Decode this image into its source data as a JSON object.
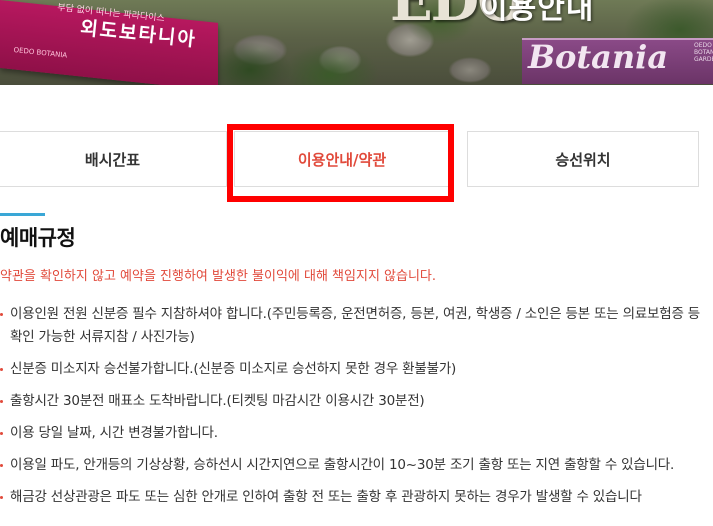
{
  "hero": {
    "sign_subtitle": "부담 없이 떠나는 파라다이스",
    "sign_title": "외도보타니아",
    "sign_small": "OEDO BOTANIA",
    "stone_letters": "EDO",
    "page_title": "이용안내",
    "purple_sign": "Botania",
    "purple_small": "OEDO BOTANIA GARDEN"
  },
  "tabs": [
    {
      "label": "배시간표"
    },
    {
      "label": "이용안내/약관"
    },
    {
      "label": "승선위치"
    }
  ],
  "active_tab_index": 1,
  "section": {
    "title": "예매규정",
    "warning": "약관을 확인하지 않고 예약을 진행하여 발생한 불이익에 대해 책임지지 않습니다.",
    "rules": [
      "이용인원 전원 신분증 필수 지참하셔야 합니다.(주민등록증, 운전면허증, 등본, 여권, 학생증 / 소인은 등본 또는 의료보험증 등 확인 가능한 서류지참 / 사진가능)",
      "신분증 미소지자 승선불가합니다.(신분증 미소지로 승선하지 못한 경우 환불불가)",
      "출항시간 30분전 매표소 도착바랍니다.(티켓팅 마감시간 이용시간 30분전)",
      "이용 당일 날짜, 시간 변경불가합니다.",
      "이용일 파도, 안개등의 기상상황, 승하선시 시간지연으로 출항시간이 10~30분 조기 출항 또는 지연 출항할 수 있습니다.",
      "해금강 선상관광은 파도 또는 심한 안개로 인하여 출항 전 또는 출항 후 관광하지 못하는 경우가 발생할 수 있습니다"
    ]
  },
  "colors": {
    "accent_red": "#e14a3b",
    "accent_blue": "#3aa7d6",
    "highlight_box": "#ff0000"
  }
}
